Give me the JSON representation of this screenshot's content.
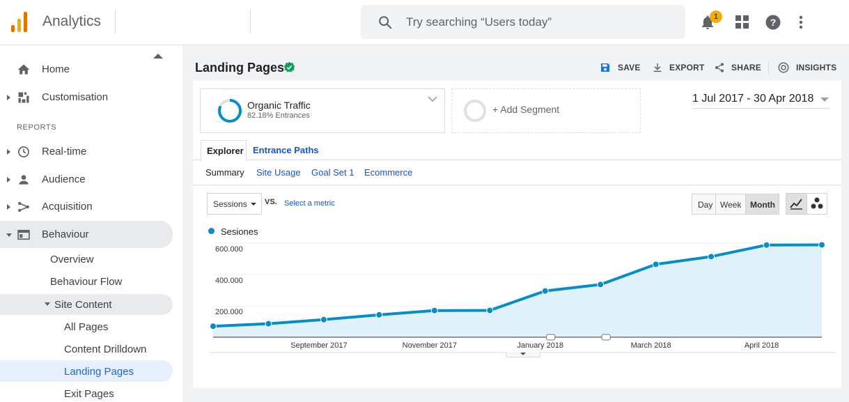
{
  "header": {
    "app_title": "Analytics",
    "search_placeholder": "Try searching “Users today”",
    "notification_count": "1",
    "logo_colors": [
      "#e37400",
      "#f9ab00",
      "#e37400"
    ]
  },
  "sidebar": {
    "items_top": [
      {
        "label": "Home",
        "icon": "home-icon"
      },
      {
        "label": "Customisation",
        "icon": "dashboard-icon"
      }
    ],
    "reports_heading": "REPORTS",
    "reports": [
      {
        "label": "Real-time",
        "icon": "clock-icon"
      },
      {
        "label": "Audience",
        "icon": "person-icon"
      },
      {
        "label": "Acquisition",
        "icon": "acquisition-icon"
      },
      {
        "label": "Behaviour",
        "icon": "behaviour-icon"
      }
    ],
    "behaviour_children": [
      "Overview",
      "Behaviour Flow",
      "Site Content"
    ],
    "site_content_children": [
      "All Pages",
      "Content Drilldown",
      "Landing Pages",
      "Exit Pages"
    ],
    "selected": "Landing Pages"
  },
  "page": {
    "title": "Landing Pages",
    "actions": [
      "SAVE",
      "EXPORT",
      "SHARE",
      "INSIGHTS"
    ],
    "segment": {
      "name": "Organic Traffic",
      "detail": "82.18% Entrances",
      "percent": 82.18
    },
    "add_segment": "+ Add Segment",
    "date_range": "1 Jul 2017 - 30 Apr 2018",
    "tabs": [
      "Explorer",
      "Entrance Paths"
    ],
    "subtabs": [
      "Summary",
      "Site Usage",
      "Goal Set 1",
      "Ecommerce"
    ],
    "metric_select": "Sessions",
    "vs_label": "VS.",
    "select_metric": "Select a metric",
    "granularity": [
      "Day",
      "Week",
      "Month"
    ],
    "granularity_selected": "Month"
  },
  "colors": {
    "accent": "#1a73e8",
    "link": "#1155cc",
    "series": "#058dc7",
    "area": "#e1f1f9",
    "check": "#0f9d58"
  },
  "chart_data": {
    "type": "area",
    "series": [
      {
        "name": "Sesiones",
        "values": [
          70000,
          86000,
          112000,
          143000,
          170000,
          171000,
          295000,
          336000,
          465000,
          514000,
          588000,
          589000
        ]
      }
    ],
    "x_ticks": [
      "September 2017",
      "November 2017",
      "January 2018",
      "March 2018",
      "April 2018"
    ],
    "y_ticks": [
      "200.000",
      "400.000",
      "600.000"
    ],
    "ylim": [
      0,
      600000
    ],
    "grid": true
  }
}
